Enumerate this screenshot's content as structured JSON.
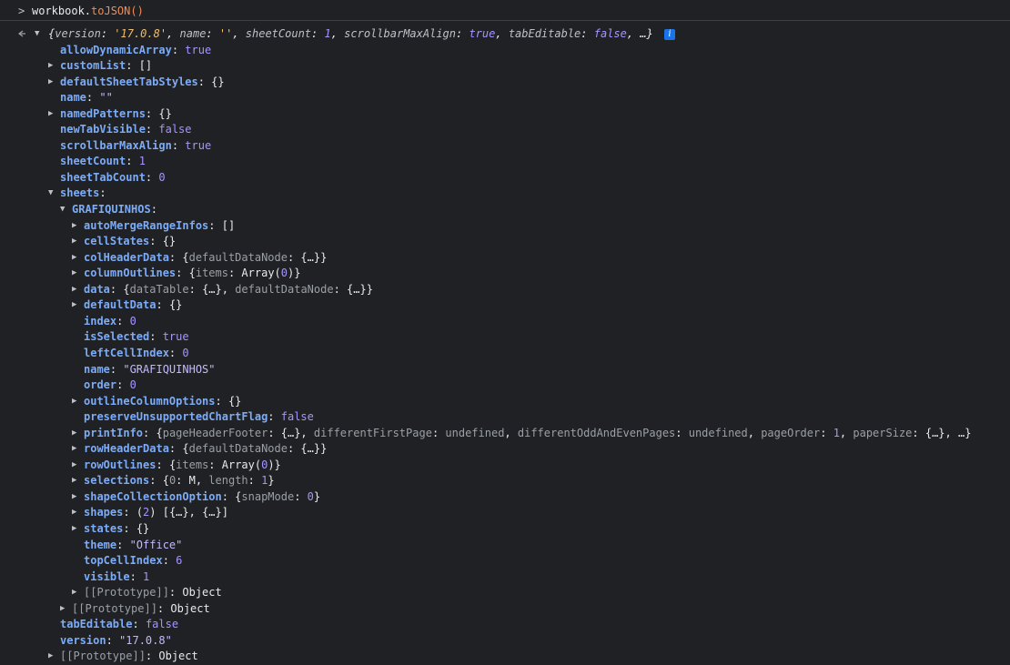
{
  "command": {
    "prompt": ">",
    "object": "workbook.",
    "method": "toJSON()"
  },
  "summary": {
    "open": "{",
    "version_key": "version",
    "version_val": "'17.0.8'",
    "name_key": "name",
    "name_val": "''",
    "sheetCount_key": "sheetCount",
    "sheetCount_val": "1",
    "scrollbar_key": "scrollbarMaxAlign",
    "scrollbar_val": "true",
    "tabEditable_key": "tabEditable",
    "tabEditable_val": "false",
    "ellipsis": "…}",
    "info": "i"
  },
  "colors": {
    "background": "#202124",
    "key": "#7cacf8",
    "keyword": "#a694ff",
    "string": "#f1bd6c",
    "method": "#f28b54"
  },
  "rows": [
    {
      "key": "allowDynamicArray",
      "val": "true",
      "type": "bool"
    },
    {
      "key": "customList",
      "val": "[]",
      "type": "obj"
    },
    {
      "key": "defaultSheetTabStyles",
      "val": "{}",
      "type": "obj"
    },
    {
      "key": "name",
      "val": "\"\"",
      "type": "str"
    },
    {
      "key": "namedPatterns",
      "val": "{}",
      "type": "obj"
    },
    {
      "key": "newTabVisible",
      "val": "false",
      "type": "bool"
    },
    {
      "key": "scrollbarMaxAlign",
      "val": "true",
      "type": "bool"
    },
    {
      "key": "sheetCount",
      "val": "1",
      "type": "num"
    },
    {
      "key": "sheetTabCount",
      "val": "0",
      "type": "num"
    },
    {
      "key": "sheets",
      "val": "",
      "type": "obj"
    },
    {
      "key": "GRAFIQUINHOS",
      "val": "",
      "type": "obj"
    },
    {
      "key": "autoMergeRangeInfos",
      "val": "[]",
      "type": "obj"
    },
    {
      "key": "cellStates",
      "val": "{}",
      "type": "obj"
    },
    {
      "key": "colHeaderData",
      "val": "{defaultDataNode: {…}}",
      "type": "obj"
    },
    {
      "key": "columnOutlines",
      "val": "{items: Array(0)}",
      "type": "obj"
    },
    {
      "key": "data",
      "val": "{dataTable: {…}, defaultDataNode: {…}}",
      "type": "obj"
    },
    {
      "key": "defaultData",
      "val": "{}",
      "type": "obj"
    },
    {
      "key": "index",
      "val": "0",
      "type": "num"
    },
    {
      "key": "isSelected",
      "val": "true",
      "type": "bool"
    },
    {
      "key": "leftCellIndex",
      "val": "0",
      "type": "num"
    },
    {
      "key": "name",
      "val": "\"GRAFIQUINHOS\"",
      "type": "str"
    },
    {
      "key": "order",
      "val": "0",
      "type": "num"
    },
    {
      "key": "outlineColumnOptions",
      "val": "{}",
      "type": "obj"
    },
    {
      "key": "preserveUnsupportedChartFlag",
      "val": "false",
      "type": "bool"
    },
    {
      "key": "printInfo",
      "val": "{pageHeaderFooter: {…}, differentFirstPage: undefined, differentOddAndEvenPages: undefined, pageOrder: 1, paperSize: {…}, …}",
      "type": "obj"
    },
    {
      "key": "rowHeaderData",
      "val": "{defaultDataNode: {…}}",
      "type": "obj"
    },
    {
      "key": "rowOutlines",
      "val": "{items: Array(0)}",
      "type": "obj"
    },
    {
      "key": "selections",
      "val": "{0: M, length: 1}",
      "type": "obj"
    },
    {
      "key": "shapeCollectionOption",
      "val": "{snapMode: 0}",
      "type": "obj"
    },
    {
      "key": "shapes",
      "val": "(2) [{…}, {…}]",
      "type": "obj"
    },
    {
      "key": "states",
      "val": "{}",
      "type": "obj"
    },
    {
      "key": "theme",
      "val": "\"Office\"",
      "type": "str"
    },
    {
      "key": "topCellIndex",
      "val": "6",
      "type": "num"
    },
    {
      "key": "visible",
      "val": "1",
      "type": "num"
    },
    {
      "key": "[[Prototype]]",
      "val": "Object",
      "type": "proto"
    },
    {
      "key": "[[Prototype]]",
      "val": "Object",
      "type": "proto"
    },
    {
      "key": "tabEditable",
      "val": "false",
      "type": "bool"
    },
    {
      "key": "version",
      "val": "\"17.0.8\"",
      "type": "str"
    },
    {
      "key": "[[Prototype]]",
      "val": "Object",
      "type": "proto"
    }
  ]
}
